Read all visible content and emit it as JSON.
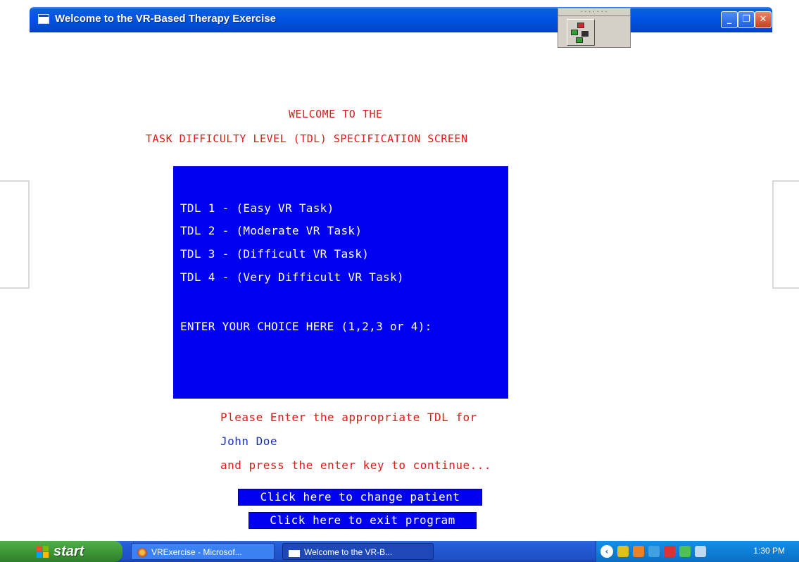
{
  "window": {
    "title": "Welcome to the VR-Based Therapy Exercise",
    "buttons": {
      "minimize": "_",
      "maximize": "❐",
      "close": "✕"
    }
  },
  "heading": {
    "line1": "WELCOME TO THE",
    "line2": "TASK DIFFICULTY LEVEL (TDL) SPECIFICATION SCREEN"
  },
  "panel": {
    "options": [
      "TDL 1 - (Easy VR Task)",
      "TDL 2 - (Moderate VR Task)",
      "TDL 3 - (Difficult VR Task)",
      "TDL 4 - (Very Difficult VR Task)"
    ],
    "prompt": "ENTER YOUR CHOICE HERE (1,2,3 or 4):"
  },
  "message": {
    "line1": "Please Enter the appropriate TDL for",
    "patient": "John Doe",
    "line3": "and press the enter key to continue..."
  },
  "actions": {
    "change_patient": "Click here to change patient",
    "exit_program": "Click here to exit program"
  },
  "taskbar": {
    "start_label": "start",
    "tasks": [
      "VRExercise - Microsof...",
      "Welcome to the VR-B..."
    ],
    "clock": "1:30 PM"
  },
  "colors": {
    "panel_bg": "#0000f0",
    "heading_text": "#e01818",
    "patient_text": "#1a2fd0",
    "titlebar": "#0053e1"
  }
}
